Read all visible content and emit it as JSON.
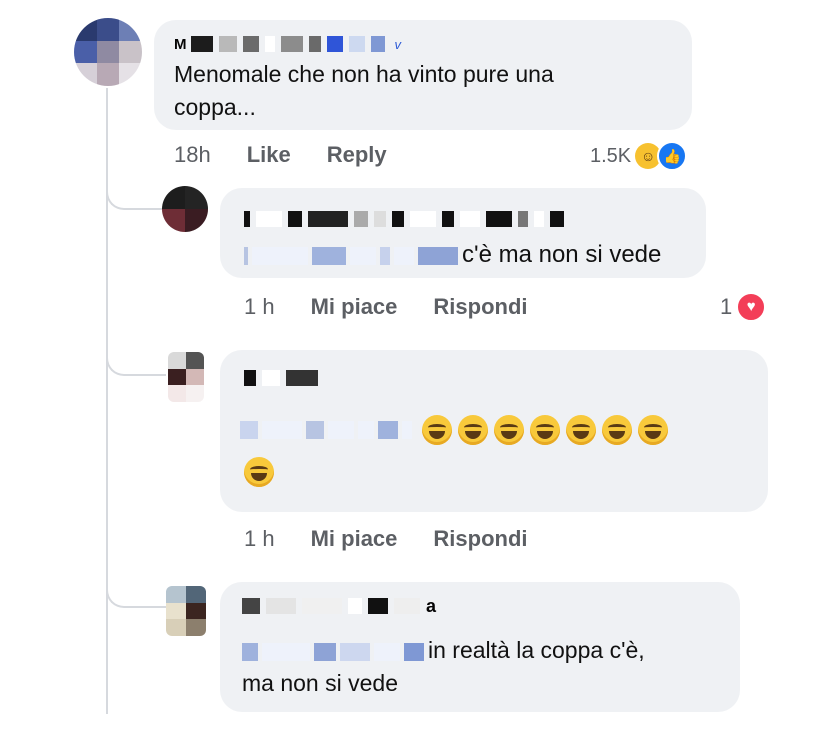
{
  "comments": [
    {
      "author_visible": "M",
      "author_suffix": "v",
      "text": "Menomale che non ha vinto pure una coppa...",
      "line1": "Menomale che non ha vinto pure una",
      "line2": "coppa...",
      "time": "18h",
      "like_label": "Like",
      "reply_label": "Reply",
      "reaction_count": "1.5K",
      "reaction_icons": [
        "haha-icon",
        "like-icon"
      ]
    },
    {
      "text": "c'è ma non si vede",
      "time": "1 h",
      "like_label": "Mi piace",
      "reply_label": "Rispondi",
      "reaction_count": "1",
      "reaction_icons": [
        "love-icon"
      ]
    },
    {
      "emoji": "😂",
      "emoji_count": 8,
      "time": "1 h",
      "like_label": "Mi piace",
      "reply_label": "Rispondi"
    },
    {
      "author_suffix": "a",
      "line1": "in realtà la coppa c'è,",
      "line2": "ma non si vede"
    }
  ],
  "colors": {
    "bubble": "#eff1f4",
    "meta_text": "#5c5f64",
    "like_blue": "#1877f2",
    "love_red": "#f33e58",
    "haha_yellow": "#f7c12f"
  }
}
